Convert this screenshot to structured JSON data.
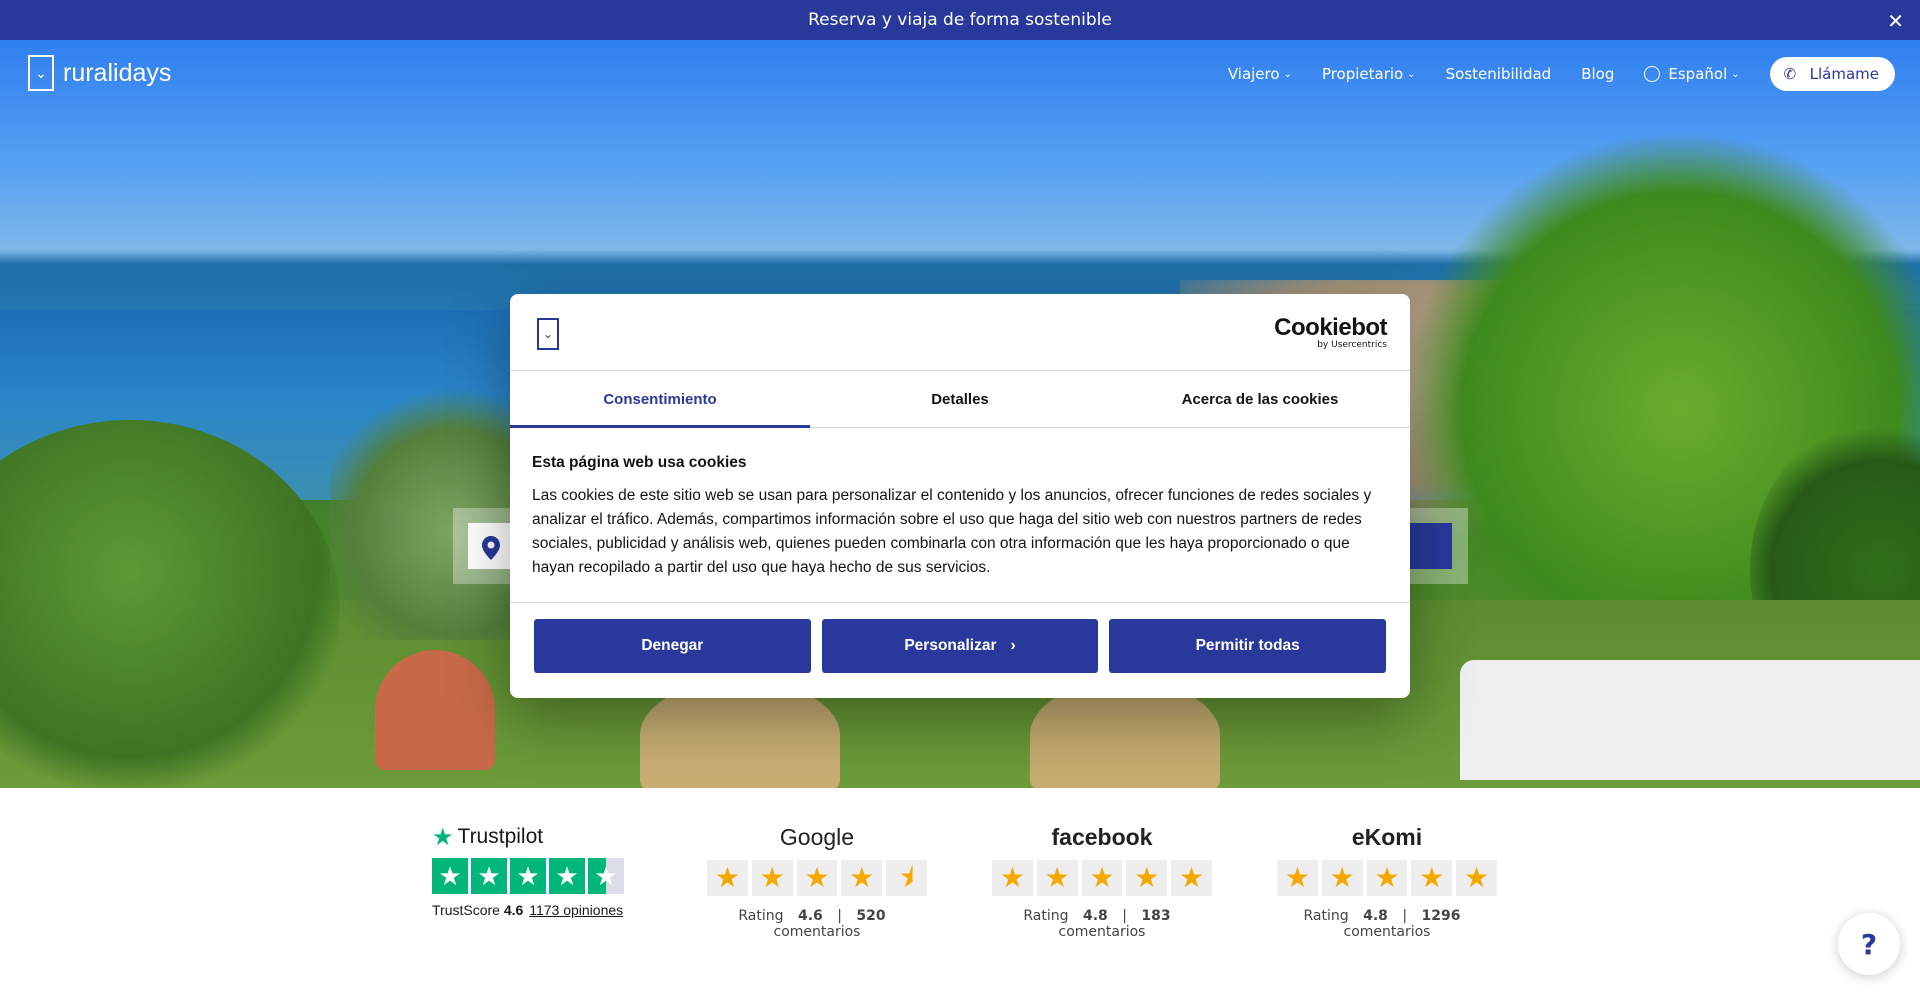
{
  "banner": {
    "text": "Reserva y viaja de forma sostenible",
    "close": "✕"
  },
  "header": {
    "logo_text": "ruralidays",
    "nav": [
      {
        "label": "Viajero",
        "has_caret": true
      },
      {
        "label": "Propietario",
        "has_caret": true
      },
      {
        "label": "Sostenibilidad",
        "has_caret": false
      },
      {
        "label": "Blog",
        "has_caret": false
      }
    ],
    "language": "Español",
    "call_button": "Llámame"
  },
  "cookie_modal": {
    "brand": "Cookiebot",
    "brand_by": "by Usercentrics",
    "tabs": [
      {
        "label": "Consentimiento",
        "active": true
      },
      {
        "label": "Detalles",
        "active": false
      },
      {
        "label": "Acerca de las cookies",
        "active": false
      }
    ],
    "heading": "Esta página web usa cookies",
    "body": "Las cookies de este sitio web se usan para personalizar el contenido y los anuncios, ofrecer funciones de redes sociales y analizar el tráfico. Además, compartimos información sobre el uso que haga del sitio web con nuestros partners de redes sociales, publicidad y análisis web, quienes pueden combinarla con otra información que les haya proporcionado o que hayan recopilado a partir del uso que haya hecho de sus servicios.",
    "buttons": {
      "deny": "Denegar",
      "customize": "Personalizar",
      "allow": "Permitir todas"
    }
  },
  "ratings": {
    "trustpilot": {
      "brand": "Trustpilot",
      "label": "TrustScore",
      "score": "4.6",
      "reviews_link": "1173 opiniones"
    },
    "google": {
      "brand": "Google",
      "rating_label": "Rating",
      "rating": "4.6",
      "separator": "|",
      "count": "520",
      "count_label": "comentarios"
    },
    "facebook": {
      "brand": "facebook",
      "rating_label": "Rating",
      "rating": "4.8",
      "separator": "|",
      "count": "183",
      "count_label": "comentarios"
    },
    "ekomi": {
      "brand": "eKomi",
      "rating_label": "Rating",
      "rating": "4.8",
      "separator": "|",
      "count": "1296",
      "count_label": "comentarios"
    }
  },
  "help_button": "?",
  "colors": {
    "brand_blue": "#28399b",
    "trustpilot_green": "#00b67a",
    "star_gold": "#f5a800"
  }
}
